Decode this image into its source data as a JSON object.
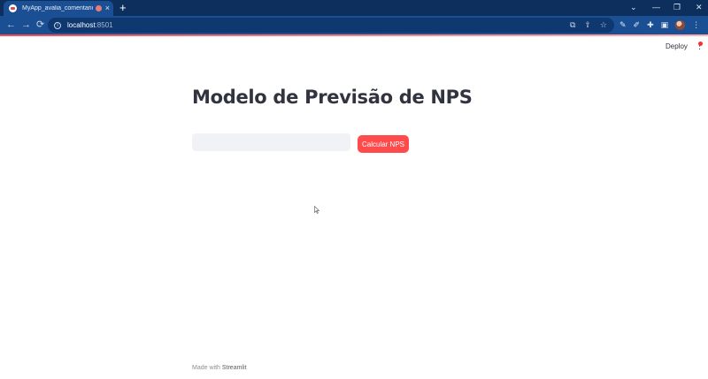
{
  "browser": {
    "tab_title": "MyApp_avalia_comentarios",
    "tab_close": "×",
    "new_tab": "+",
    "url_host": "localhost",
    "url_port": ":8501",
    "window_buttons": {
      "menu": "⌄",
      "minimize": "—",
      "restore": "❐",
      "close": "✕"
    }
  },
  "app": {
    "deploy_label": "Deploy",
    "title": "Modelo de Previsão de NPS",
    "input": {
      "value": "",
      "placeholder": ""
    },
    "button_label": "Calcular NPS",
    "footer_prefix": "Made with",
    "footer_brand": "Streamlit"
  },
  "colors": {
    "accent": "#ff4b4b",
    "chrome": "#1b4f93",
    "tabstrip": "#0d2f5e"
  }
}
